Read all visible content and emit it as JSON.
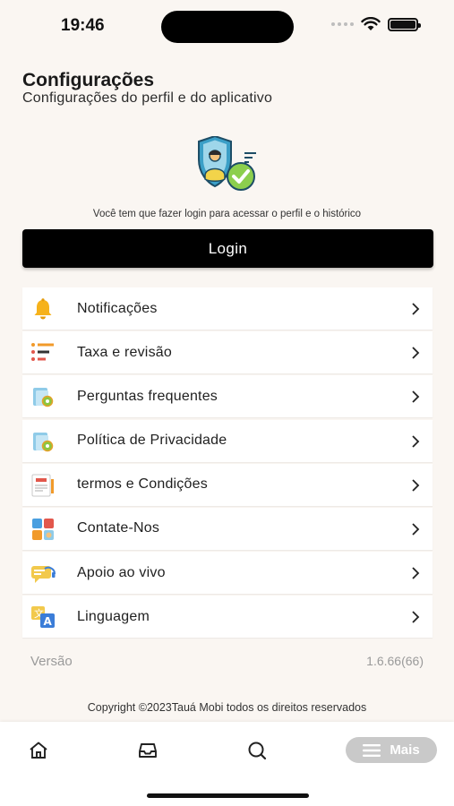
{
  "status_bar": {
    "time": "19:46"
  },
  "header": {
    "title": "Configurações",
    "subtitle": "Configurações do perfil e do aplicativo"
  },
  "login": {
    "prompt": "Você tem que fazer login para acessar o perfil e o histórico",
    "button_label": "Login"
  },
  "menu": {
    "items": [
      {
        "label": "Notificações",
        "icon": "bell-icon"
      },
      {
        "label": "Taxa e revisão",
        "icon": "rating-list-icon"
      },
      {
        "label": "Perguntas frequentes",
        "icon": "faq-folder-icon"
      },
      {
        "label": "Política de Privacidade",
        "icon": "privacy-folder-icon"
      },
      {
        "label": "termos e Condições",
        "icon": "terms-document-icon"
      },
      {
        "label": "Contate-Nos",
        "icon": "contact-grid-icon"
      },
      {
        "label": "Apoio ao vivo",
        "icon": "live-support-chat-icon"
      },
      {
        "label": "Linguagem",
        "icon": "translate-icon"
      }
    ]
  },
  "version": {
    "label": "Versão",
    "value": "1.6.66(66)"
  },
  "copyright": "Copyright ©2023Tauá Mobi todos os direitos reservados",
  "bottom_nav": {
    "items": [
      {
        "icon": "home-icon"
      },
      {
        "icon": "inbox-icon"
      },
      {
        "icon": "search-icon"
      }
    ],
    "more_label": "Mais"
  },
  "colors": {
    "background": "#faf6f2",
    "login_button": "#000000",
    "more_pill": "#c9c9c9"
  }
}
